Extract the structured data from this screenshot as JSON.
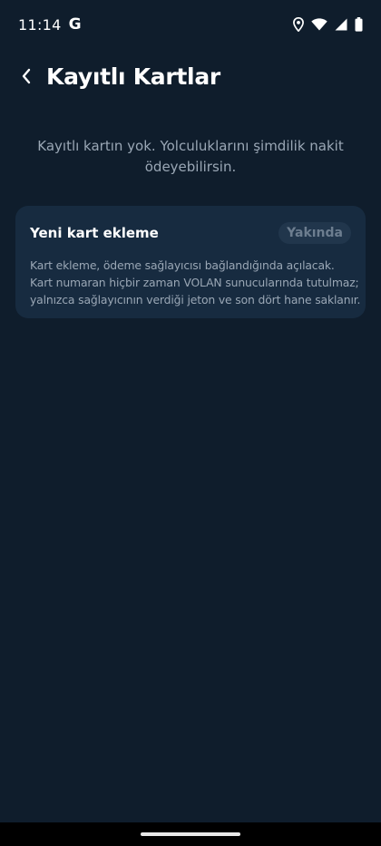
{
  "status_bar": {
    "time": "11:14",
    "google_badge": "G",
    "icons": [
      "location-icon",
      "wifi-icon",
      "signal-icon",
      "battery-icon"
    ]
  },
  "header": {
    "title": "Kayıtlı Kartlar"
  },
  "empty_state": {
    "message": "Kayıtlı kartın yok. Yolculuklarını şimdilik nakit ödeyebilirsin."
  },
  "add_card": {
    "title": "Yeni kart ekleme",
    "badge": "Yakında",
    "description_lines": [
      "Kart ekleme, ödeme sağlayıcısı bağlandığında açılacak.",
      "Kart numaran hiçbir zaman VOLAN sunucularında tutulmaz;",
      "yalnızca sağlayıcının verdiği jeton ve son dört hane saklanır."
    ]
  },
  "colors": {
    "background": "#0f1d2c",
    "card": "#172b40",
    "muted_text": "#9aa7b5",
    "badge_bg": "#21364c",
    "badge_text": "#6c7d8f"
  }
}
